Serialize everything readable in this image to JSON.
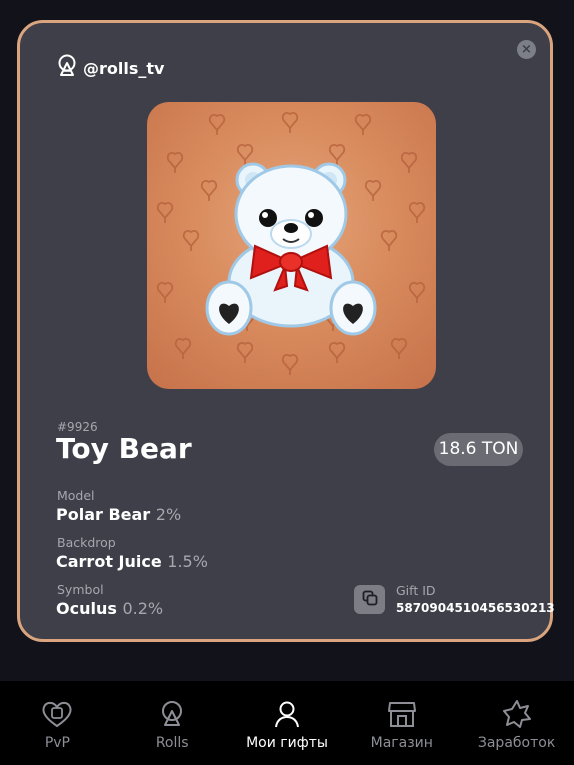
{
  "card": {
    "channel": {
      "name": "@rolls_tv",
      "icon": "rolls-logo-icon"
    },
    "close_icon": "close-icon",
    "gift": {
      "number": "#9926",
      "title": "Toy Bear",
      "price": "18.6 TON",
      "image": "toy-bear-image"
    },
    "attributes": {
      "model": {
        "label": "Model",
        "value": "Polar Bear",
        "percent": "2%"
      },
      "backdrop": {
        "label": "Backdrop",
        "value": "Carrot Juice",
        "percent": "1.5%"
      },
      "symbol": {
        "label": "Symbol",
        "value": "Oculus",
        "percent": "0.2%"
      }
    },
    "gift_id": {
      "label": "Gift ID",
      "value": "5870904510456530213",
      "icon": "copy-icon"
    }
  },
  "nav": {
    "items": [
      {
        "label": "PvP",
        "icon": "heart-icon",
        "active": false
      },
      {
        "label": "Rolls",
        "icon": "rolls-logo-icon",
        "active": false
      },
      {
        "label": "Мои гифты",
        "icon": "user-icon",
        "active": true
      },
      {
        "label": "Магазин",
        "icon": "store-icon",
        "active": false
      },
      {
        "label": "Заработок",
        "icon": "star-badge-icon",
        "active": false
      }
    ]
  },
  "colors": {
    "page_bg": "#12131a",
    "card_bg": "#3e3f48",
    "card_border": "#d9a47e",
    "backdrop": "#d98c5e",
    "nav_bg": "#000000",
    "nav_active": "#ffffff",
    "nav_inactive": "#8e8f96"
  }
}
